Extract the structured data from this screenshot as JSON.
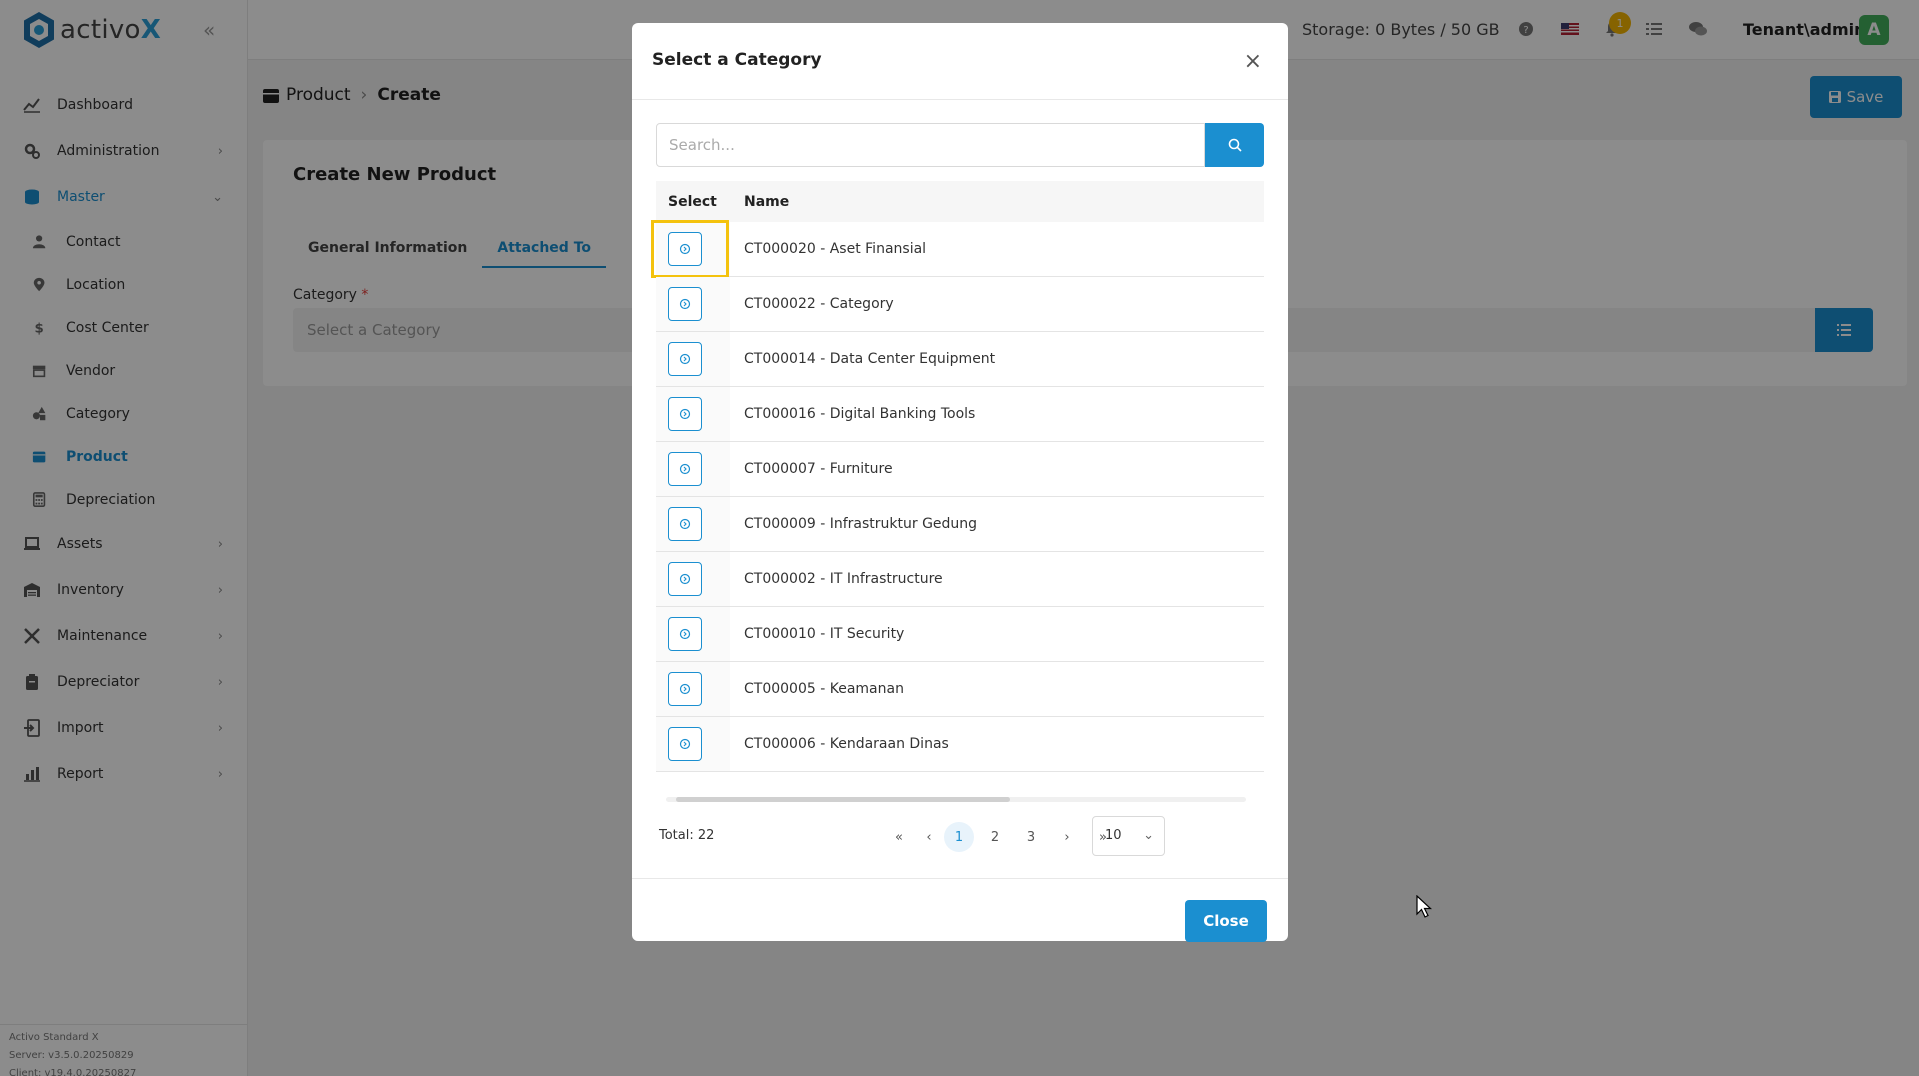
{
  "brand": {
    "name_prefix": "activo",
    "name_suffix": "X"
  },
  "sidebar": {
    "items": [
      {
        "label": "Dashboard",
        "icon": "chart-line-icon"
      },
      {
        "label": "Administration",
        "icon": "cogs-icon",
        "has_children": true
      },
      {
        "label": "Master",
        "icon": "database-icon",
        "expanded": true
      },
      {
        "label": "Assets",
        "icon": "laptop-icon",
        "has_children": true
      },
      {
        "label": "Inventory",
        "icon": "warehouse-icon",
        "has_children": true
      },
      {
        "label": "Maintenance",
        "icon": "tools-icon",
        "has_children": true
      },
      {
        "label": "Depreciator",
        "icon": "clipboard-icon",
        "has_children": true
      },
      {
        "label": "Import",
        "icon": "file-import-icon",
        "has_children": true
      },
      {
        "label": "Report",
        "icon": "chart-bar-icon",
        "has_children": true
      }
    ],
    "master_children": [
      {
        "label": "Contact",
        "icon": "user-icon"
      },
      {
        "label": "Location",
        "icon": "map-marker-icon"
      },
      {
        "label": "Cost Center",
        "icon": "dollar-icon"
      },
      {
        "label": "Vendor",
        "icon": "store-icon"
      },
      {
        "label": "Category",
        "icon": "shapes-icon"
      },
      {
        "label": "Product",
        "icon": "box-icon",
        "active": true
      },
      {
        "label": "Depreciation",
        "icon": "calculator-icon"
      }
    ],
    "footer": {
      "line1": "Activo Standard X",
      "line2": "Server: v3.5.0.20250829",
      "line3": "Client: v19.4.0.20250827"
    }
  },
  "topbar": {
    "storage": "Storage: 0 Bytes / 50 GB",
    "notification_count": "1",
    "user": "Tenant\\admin",
    "avatar_letter": "A"
  },
  "page": {
    "breadcrumb": [
      "Product",
      "Create"
    ],
    "save_label": "Save",
    "card_title": "Create New Product",
    "tabs": [
      "General Information",
      "Attached To"
    ],
    "active_tab": "Attached To",
    "category_label": "Category",
    "required_mark": "*",
    "category_placeholder": "Select a Category"
  },
  "modal": {
    "title": "Select a Category",
    "search_placeholder": "Search...",
    "columns": [
      "Select",
      "Name"
    ],
    "rows": [
      "CT000020 - Aset Finansial",
      "CT000022 - Category",
      "CT000014 - Data Center Equipment",
      "CT000016 - Digital Banking Tools",
      "CT000007 - Furniture",
      "CT000009 - Infrastruktur Gedung",
      "CT000002 - IT Infrastructure",
      "CT000010 - IT Security",
      "CT000005 - Keamanan",
      "CT000006 - Kendaraan Dinas"
    ],
    "total": "Total: 22",
    "pages": [
      "1",
      "2",
      "3"
    ],
    "current_page": "1",
    "page_size": "10",
    "close_label": "Close"
  },
  "colors": {
    "accent": "#1b8fd0",
    "highlight": "#f4c20d",
    "avatar": "#43b05c",
    "badge": "#f4b400"
  }
}
